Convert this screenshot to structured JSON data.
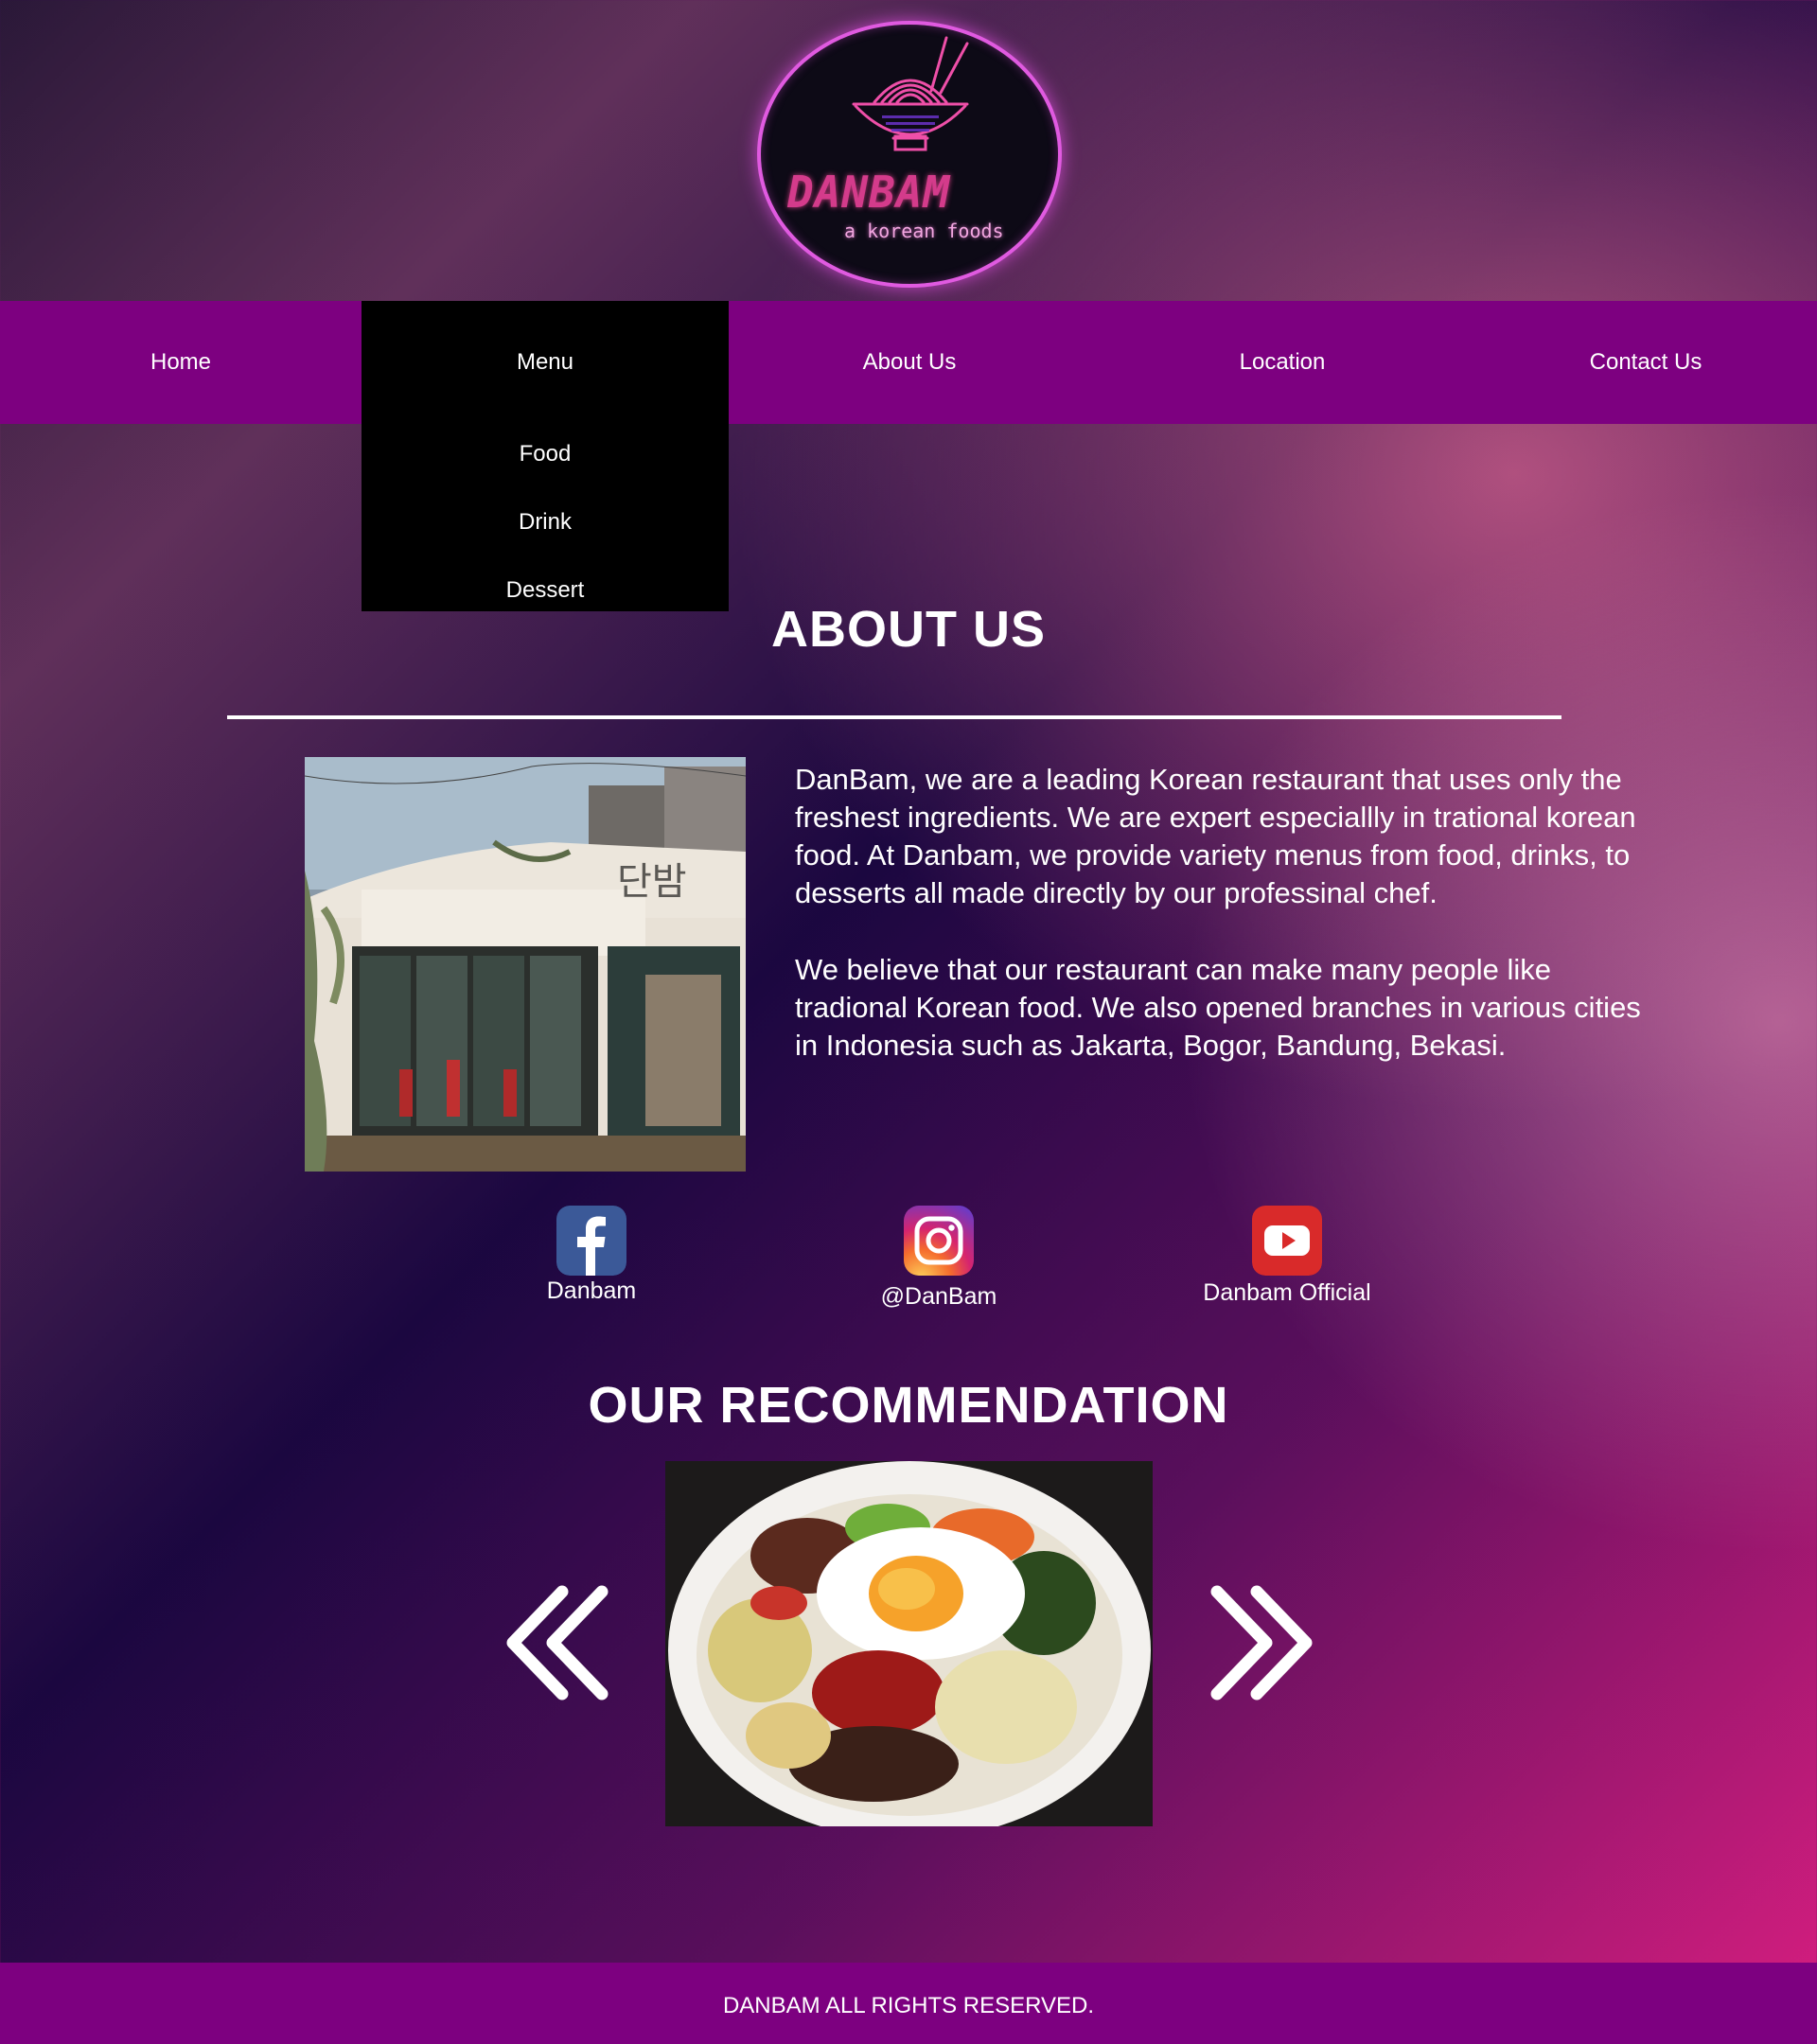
{
  "brand": {
    "name": "DANBAM",
    "tagline": "a korean foods"
  },
  "nav": {
    "items": [
      {
        "label": "Home"
      },
      {
        "label": "Menu",
        "active": true
      },
      {
        "label": "About Us"
      },
      {
        "label": "Location"
      },
      {
        "label": "Contact Us"
      }
    ],
    "dropdown": [
      "Food",
      "Drink",
      "Dessert"
    ]
  },
  "about": {
    "title": "ABOUT US",
    "paragraphs": [
      "DanBam, we are a leading Korean restaurant that uses only the freshest ingredients. We are expert especiallly in trational korean food. At Danbam, we provide variety menus from food, drinks, to desserts all made directly by our professinal chef.",
      "We believe that our restaurant can make many people like tradional Korean food. We also opened branches in various cities in Indonesia such as Jakarta, Bogor, Bandung, Bekasi."
    ],
    "storefront_sign": "단밤"
  },
  "social": [
    {
      "icon": "facebook-icon",
      "label": "Danbam"
    },
    {
      "icon": "instagram-icon",
      "label": "@DanBam"
    },
    {
      "icon": "youtube-icon",
      "label": "Danbam Official"
    }
  ],
  "recommendation": {
    "title": "OUR RECOMMENDATION",
    "prev_icon": "chevron-double-left-icon",
    "next_icon": "chevron-double-right-icon"
  },
  "footer": {
    "text": "DANBAM ALL RIGHTS RESERVED."
  },
  "colors": {
    "nav_background": "#7d0080",
    "dropdown_background": "#000000",
    "logo_ring": "#e05ae0",
    "brand_pink": "#d43b8b",
    "text": "#ffffff"
  }
}
